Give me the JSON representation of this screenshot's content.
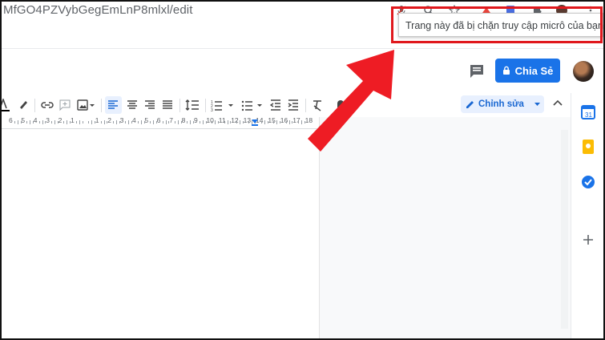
{
  "browser": {
    "url": "MfGO4PZVybGegEmLnP8mlxl/edit"
  },
  "tooltip": {
    "text": "Trang này đã bị chặn truy cập micrô của bạn."
  },
  "header": {
    "share_label": "Chia Sẻ"
  },
  "toolbar": {
    "editing_mode": "Chỉnh sửa"
  },
  "ruler": {
    "labels": [
      "6",
      "5",
      "4",
      "3",
      "2",
      "1",
      "",
      "1",
      "2",
      "3",
      "4",
      "5",
      "6",
      "7",
      "8",
      "9",
      "10",
      "11",
      "12",
      "13",
      "14",
      "15",
      "16",
      "17",
      "18"
    ]
  },
  "colors": {
    "accent": "#1a73e8",
    "highlight": "#e0181d",
    "arrow": "#ee1c24"
  },
  "icons": {
    "side_panel": [
      "calendar-icon",
      "keep-icon",
      "tasks-icon",
      "add-icon"
    ]
  }
}
